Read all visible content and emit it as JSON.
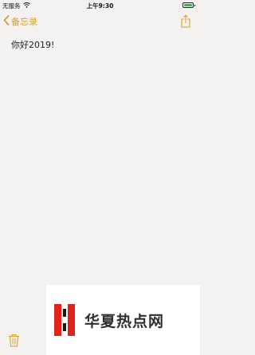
{
  "status_bar": {
    "carrier": "无服务",
    "time": "上午9:30",
    "battery_color": "#21c04a"
  },
  "nav": {
    "back_label": "备忘录",
    "accent_color": "#d6a12a",
    "back_icon": "chevron-left-icon",
    "share_icon": "share-icon"
  },
  "note": {
    "text": "你好2019!"
  },
  "toolbar": {
    "trash_icon": "trash-icon"
  },
  "watermark": {
    "text": "华夏热点网"
  }
}
